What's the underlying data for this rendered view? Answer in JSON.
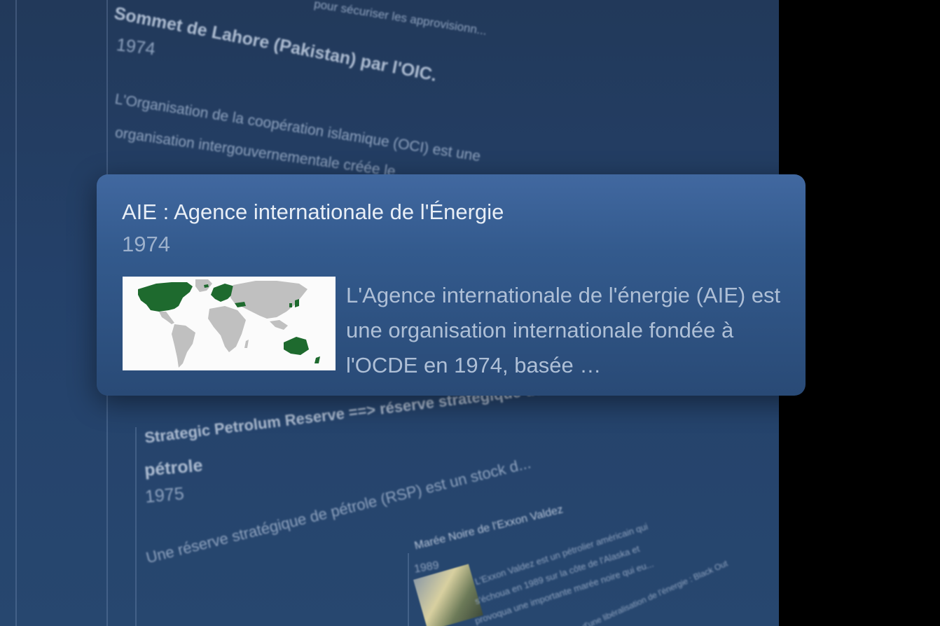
{
  "background": {
    "lahore": {
      "top_fragment": "pour sécuriser les approvisionn...",
      "title_line1": "Sommet de Lahore (Pakistan) par l'OIC.",
      "year": "1974",
      "desc_line1": "L'Organisation de la coopération islamique (OCI) est une",
      "desc_line2": "organisation intergouvernementale créée le..."
    },
    "spr": {
      "title_line1": "Strategic Petrolum Reserve ==> réserve stratégique de",
      "title_line2": "pétrole",
      "year": "1975",
      "desc": "Une réserve stratégique de pétrole (RSP) est un stock d..."
    },
    "exxon": {
      "title": "Marée Noire de l'Exxon Valdez",
      "year": "1989",
      "desc_line1": "L'Exxon Valdez est un pétrolier américain qui",
      "desc_line2": "s'échoua en 1989 sur la côte de l'Alaska et",
      "desc_line3": "provoqua une importante marée noire qui eu...",
      "side_fragment": "...es d'une libéralisation de l'énergie : Black Out"
    }
  },
  "card": {
    "title": "AIE : Agence internationale de l'Énergie",
    "year": "1974",
    "description": "L'Agence internationale de l'énergie (AIE) est une organisation internationale fondée à l'OCDE en 1974, basée …",
    "map_member_color": "#1e6a2e",
    "map_land_color": "#c0c0c0"
  }
}
